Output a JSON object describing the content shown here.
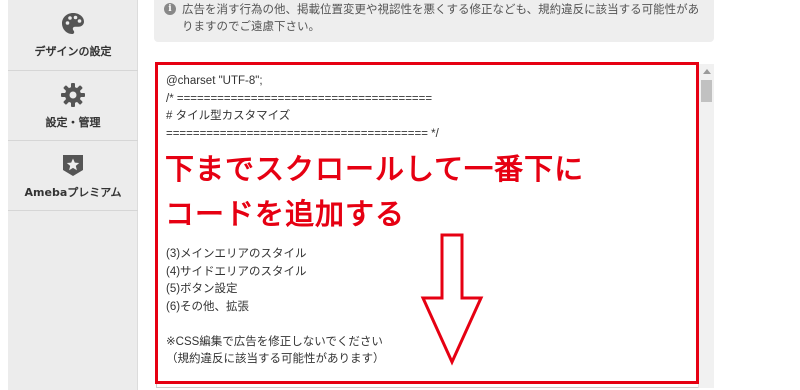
{
  "sidebar": {
    "items": [
      {
        "label": "デザインの設定",
        "icon": "palette-icon"
      },
      {
        "label": "設定・管理",
        "icon": "gear-icon"
      },
      {
        "label": "Amebaプレミアム",
        "icon": "star-badge-icon"
      }
    ]
  },
  "notice": {
    "icon": "info-icon",
    "line1": "広告を消す行為の他、掲載位置変更や視認性を悪くする修正なども、規約違反に該当する可能性があ",
    "line2": "りますのでご遠慮下さい。"
  },
  "editor": {
    "code_top": "@charset \"UTF-8\";\n/* ======================================\n# タイル型カスタマイズ\n======================================= */",
    "code_bottom": "(3)メインエリアのスタイル\n(4)サイドエリアのスタイル\n(5)ボタン設定\n(6)その他、拡張\n\n※CSS編集で広告を修正しないでください\n（規約違反に該当する可能性があります）"
  },
  "annotation": {
    "line1": "下までスクロールして一番下に",
    "line2": "コードを追加する",
    "color": "#e60012"
  },
  "colors": {
    "sidebar_bg": "#ececec",
    "notice_bg": "#eeeeee",
    "annotation_red": "#e60012"
  }
}
